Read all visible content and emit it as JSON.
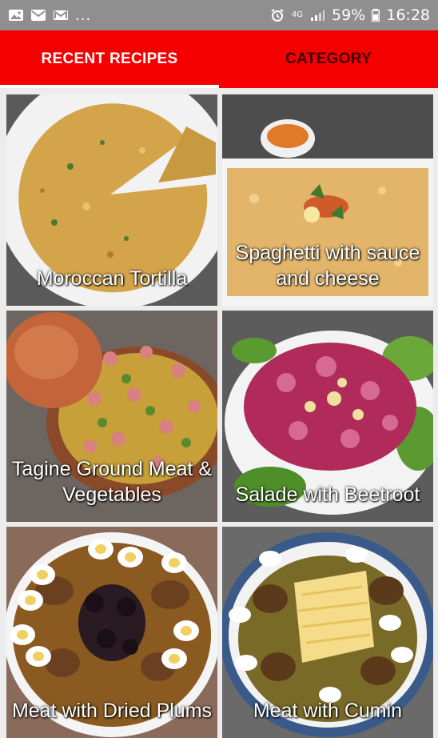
{
  "status_bar": {
    "left_icons": [
      "gallery-icon",
      "messages-icon",
      "mail-icon"
    ],
    "more": "...",
    "network": "4G",
    "battery": "59%",
    "time": "16:28"
  },
  "tabs": [
    {
      "label": "RECENT RECIPES",
      "selected": true
    },
    {
      "label": "CATEGORY",
      "selected": false
    }
  ],
  "colors": {
    "accent": "#f40000",
    "status_bar": "#8f8f8f"
  },
  "recipes": [
    {
      "title": "Moroccan Tortilla"
    },
    {
      "title": "Spaghetti with sauce and cheese"
    },
    {
      "title": "Tagine Ground Meat & Vegetables"
    },
    {
      "title": "Salade with Beetroot"
    },
    {
      "title": "Meat with Dried Plums"
    },
    {
      "title": "Meat with Cumin"
    }
  ]
}
